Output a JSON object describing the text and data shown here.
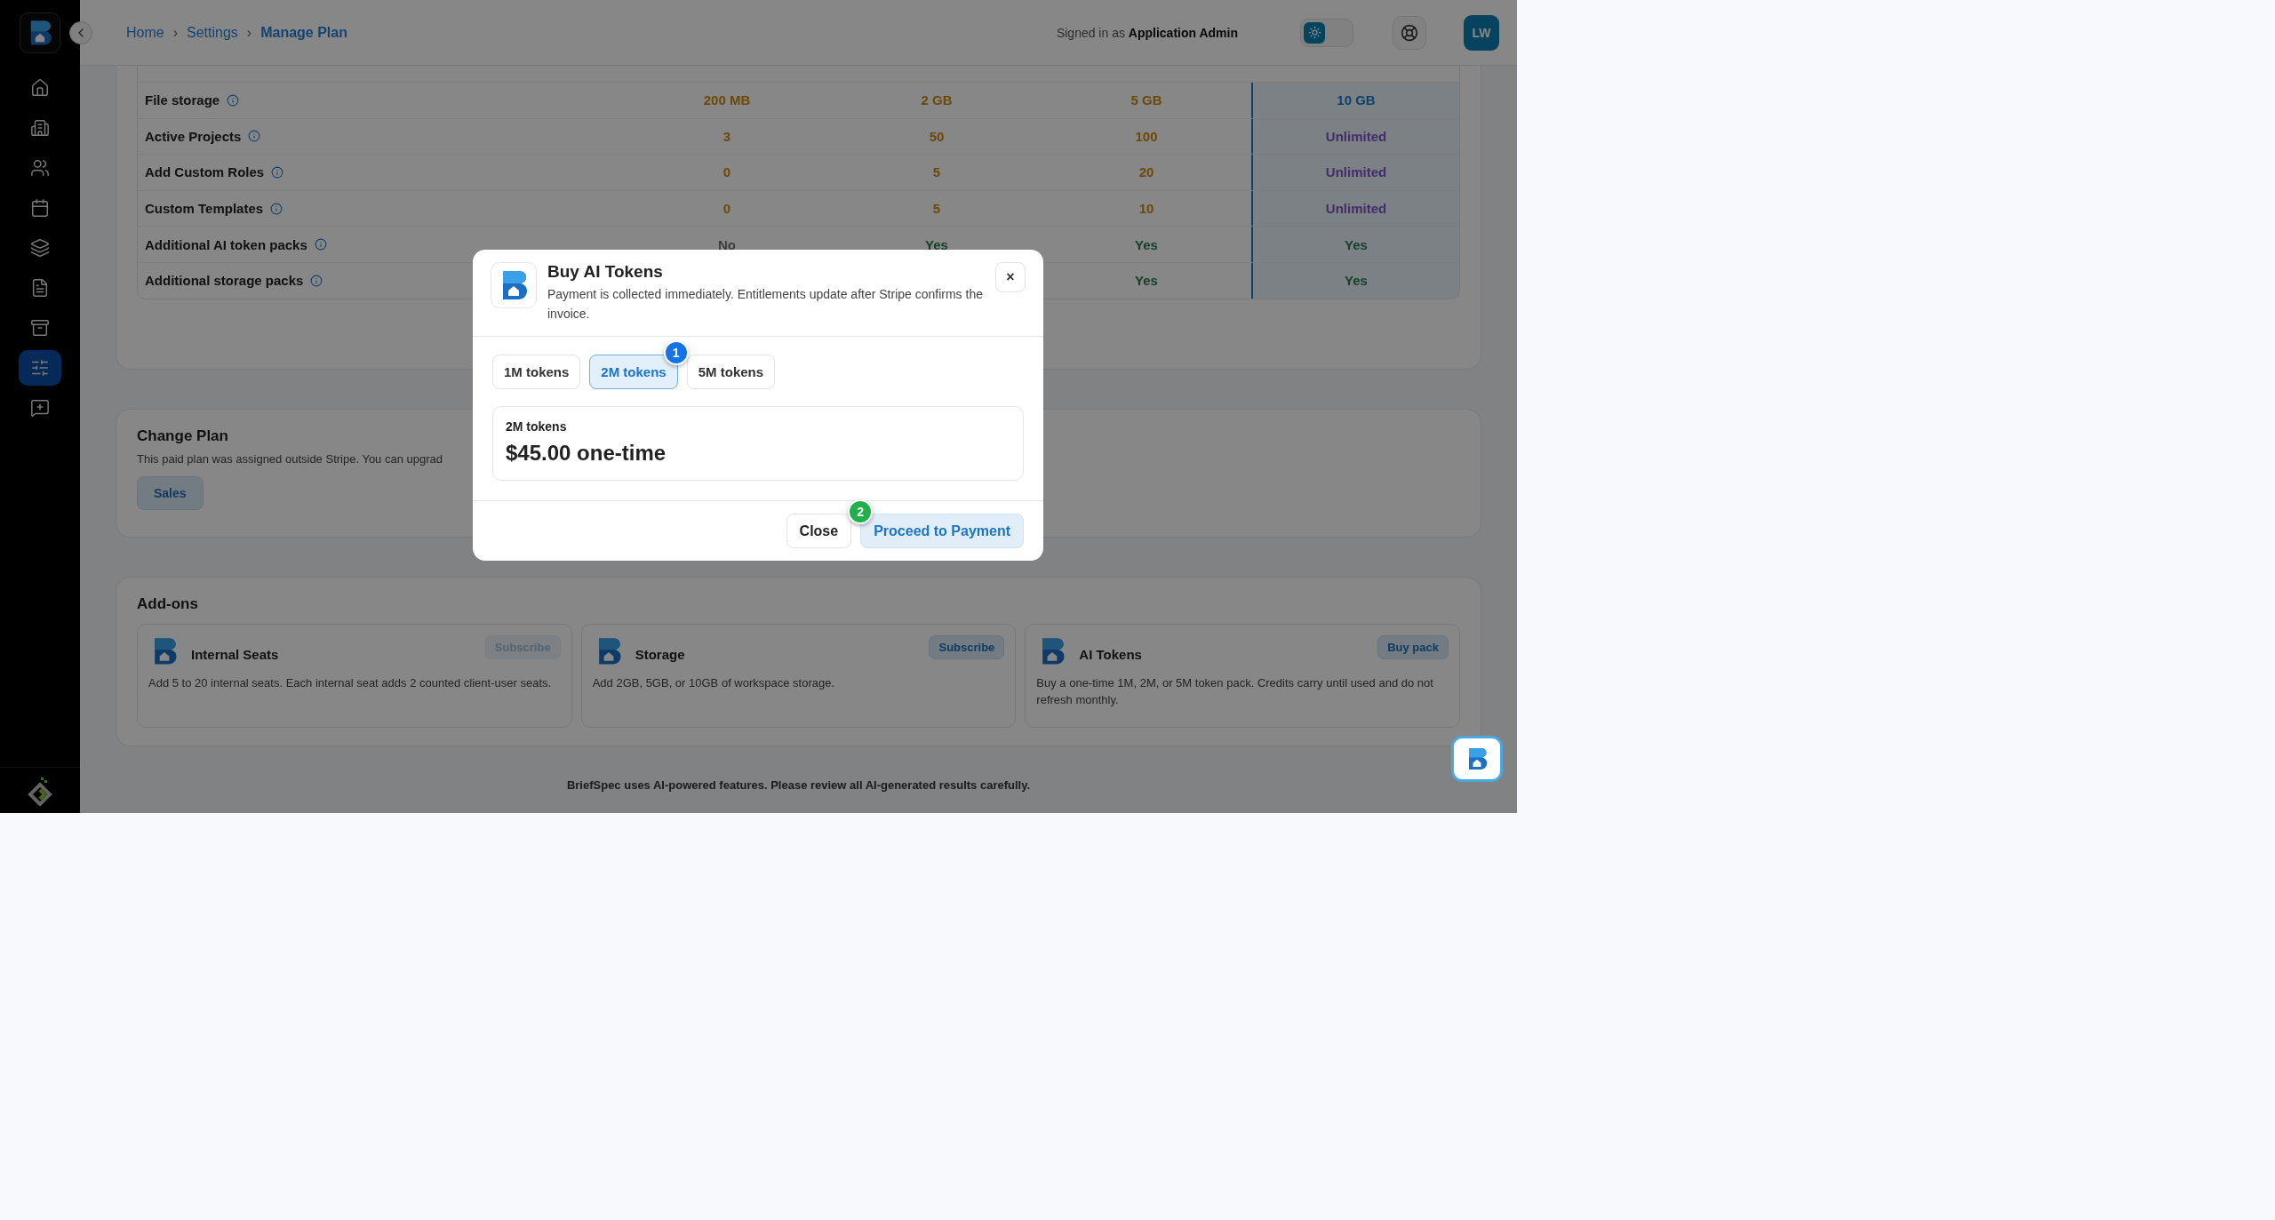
{
  "sidebar": {
    "items": [
      {
        "selected": false
      },
      {
        "selected": false
      },
      {
        "selected": false
      },
      {
        "selected": false
      },
      {
        "selected": false
      },
      {
        "selected": false
      },
      {
        "selected": false
      },
      {
        "selected": true
      },
      {
        "selected": false
      }
    ]
  },
  "topbar": {
    "breadcrumb": [
      {
        "label": "Home",
        "kind": "link"
      },
      {
        "label": "›",
        "kind": "separator"
      },
      {
        "label": "Settings",
        "kind": "link"
      },
      {
        "label": "›",
        "kind": "separator"
      },
      {
        "label": "Manage Plan",
        "kind": "current"
      }
    ],
    "signed_in_prefix": "Signed in as",
    "signed_in_user": "Application Admin",
    "theme_toggle": {
      "on": false
    },
    "avatar": "LW"
  },
  "plan_table": {
    "columns": [
      {
        "selected": false
      },
      {
        "selected": false
      },
      {
        "selected": false
      },
      {
        "selected": true
      }
    ],
    "rows": [
      {
        "label": "File storage",
        "cells": [
          {
            "text": "200 MB",
            "kind": "limit"
          },
          {
            "text": "2 GB",
            "kind": "limit"
          },
          {
            "text": "5 GB",
            "kind": "limit"
          },
          {
            "text": "10 GB",
            "kind": "top"
          }
        ]
      },
      {
        "label": "Active Projects",
        "cells": [
          {
            "text": "3",
            "kind": "limit"
          },
          {
            "text": "50",
            "kind": "limit"
          },
          {
            "text": "100",
            "kind": "limit"
          },
          {
            "text": "Unlimited",
            "kind": "unlimited"
          }
        ]
      },
      {
        "label": "Add Custom Roles",
        "cells": [
          {
            "text": "0",
            "kind": "limit"
          },
          {
            "text": "5",
            "kind": "limit"
          },
          {
            "text": "20",
            "kind": "limit"
          },
          {
            "text": "Unlimited",
            "kind": "unlimited"
          }
        ]
      },
      {
        "label": "Custom Templates",
        "cells": [
          {
            "text": "0",
            "kind": "limit"
          },
          {
            "text": "5",
            "kind": "limit"
          },
          {
            "text": "10",
            "kind": "limit"
          },
          {
            "text": "Unlimited",
            "kind": "unlimited"
          }
        ]
      },
      {
        "label": "Additional AI token packs",
        "cells": [
          {
            "text": "No",
            "kind": "no"
          },
          {
            "text": "Yes",
            "kind": "yes"
          },
          {
            "text": "Yes",
            "kind": "yes"
          },
          {
            "text": "Yes",
            "kind": "yes"
          }
        ]
      },
      {
        "label": "Additional storage packs",
        "cells": [
          {
            "text": ""
          },
          {
            "text": ""
          },
          {
            "text": "Yes",
            "kind": "yes"
          },
          {
            "text": "Yes",
            "kind": "yes"
          }
        ]
      }
    ]
  },
  "change_plan": {
    "title": "Change Plan",
    "text": "This paid plan was assigned outside Stripe. You can upgrad",
    "button": "Sales"
  },
  "addons": {
    "title": "Add-ons",
    "items": [
      {
        "name": "Internal Seats",
        "button": "Subscribe",
        "disabled": true,
        "description": "Add 5 to 20 internal seats. Each internal seat adds 2 counted client-user seats."
      },
      {
        "name": "Storage",
        "button": "Subscribe",
        "disabled": false,
        "description": "Add 2GB, 5GB, or 10GB of workspace storage."
      },
      {
        "name": "AI Tokens",
        "button": "Buy pack",
        "disabled": false,
        "description": "Buy a one-time 1M, 2M, or 5M token pack. Credits carry until used and do not refresh monthly."
      }
    ]
  },
  "footer": "BriefSpec uses AI-powered features. Please review all AI-generated results carefully.",
  "dialog": {
    "title": "Buy AI Tokens",
    "description": "Payment is collected immediately. Entitlements update after Stripe confirms the invoice.",
    "close": "×",
    "options": [
      {
        "label": "1M tokens",
        "selected": false
      },
      {
        "label": "2M tokens",
        "selected": true,
        "marker": "1"
      },
      {
        "label": "5M tokens",
        "selected": false
      }
    ],
    "summary_label": "2M tokens",
    "price": "$45.00 one-time",
    "buttons": [
      {
        "label": "Close",
        "kind": "secondary"
      },
      {
        "label": "Proceed to Payment",
        "kind": "primary",
        "marker": "2"
      }
    ]
  }
}
